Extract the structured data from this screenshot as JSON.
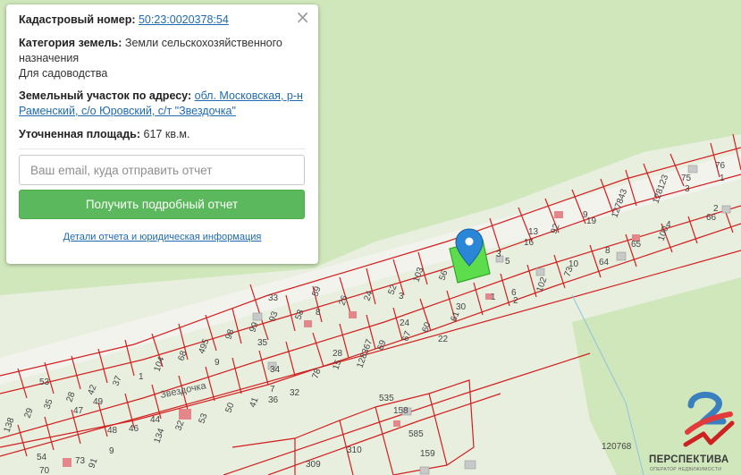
{
  "popup": {
    "cadastral_label": "Кадастровый номер:",
    "cadastral_value": "50:23:0020378:54",
    "category_label": "Категория земель:",
    "category_value_1": "Земли сельскохозяйственного",
    "category_value_2": "назначения",
    "category_value_3": "Для садоводства",
    "address_label": "Земельный участок по адресу:",
    "address_value_1": "обл. Московская, р-н",
    "address_value_2": "Раменский, с/о Юровский, с/т \"Звездочка\"",
    "area_label": "Уточненная площадь:",
    "area_value": "617 кв.м.",
    "email_placeholder": "Ваш email, куда отправить отчет",
    "report_button": "Получить подробный отчет",
    "details_link": "Детали отчета и юридическая информация",
    "close_symbol": "×"
  },
  "map": {
    "street_label": "Звездочка",
    "selected_color": "#5ddc4c",
    "boundary_color": "#d21e1e",
    "marker_color": "#2a86d6",
    "lots_upper": [
      "76",
      "75",
      "3",
      "1",
      "66",
      "2",
      "4",
      "100",
      "65",
      "8",
      "64",
      "127843",
      "128123",
      "9",
      "19",
      "92",
      "13",
      "16",
      "3",
      "5",
      "10",
      "73",
      "102",
      "6",
      "2",
      "1",
      "56",
      "103",
      "52",
      "3",
      "24",
      "26",
      "59",
      "8",
      "58",
      "33",
      "93",
      "99",
      "35",
      "98",
      "9",
      "495",
      "68",
      "104",
      "1",
      "37",
      "42",
      "49",
      "28",
      "47",
      "35",
      "53",
      "29",
      "138",
      "30",
      "61",
      "8",
      "60",
      "22",
      "67",
      "24",
      "69",
      "128367",
      "28",
      "15",
      "78",
      "34",
      "32",
      "7",
      "36",
      "41",
      "50",
      "53",
      "44",
      "134",
      "46",
      "48",
      "91",
      "73",
      "9",
      "54",
      "70"
    ],
    "lots_lower": [
      "535",
      "158",
      "585",
      "159",
      "310",
      "309",
      "120768"
    ]
  },
  "logo": {
    "name": "ПЕРСПЕКТИВА",
    "tagline": "ОПЕРАТОР НЕДВИЖИМОСТИ",
    "icon": "perspektiva-logo-icon"
  }
}
